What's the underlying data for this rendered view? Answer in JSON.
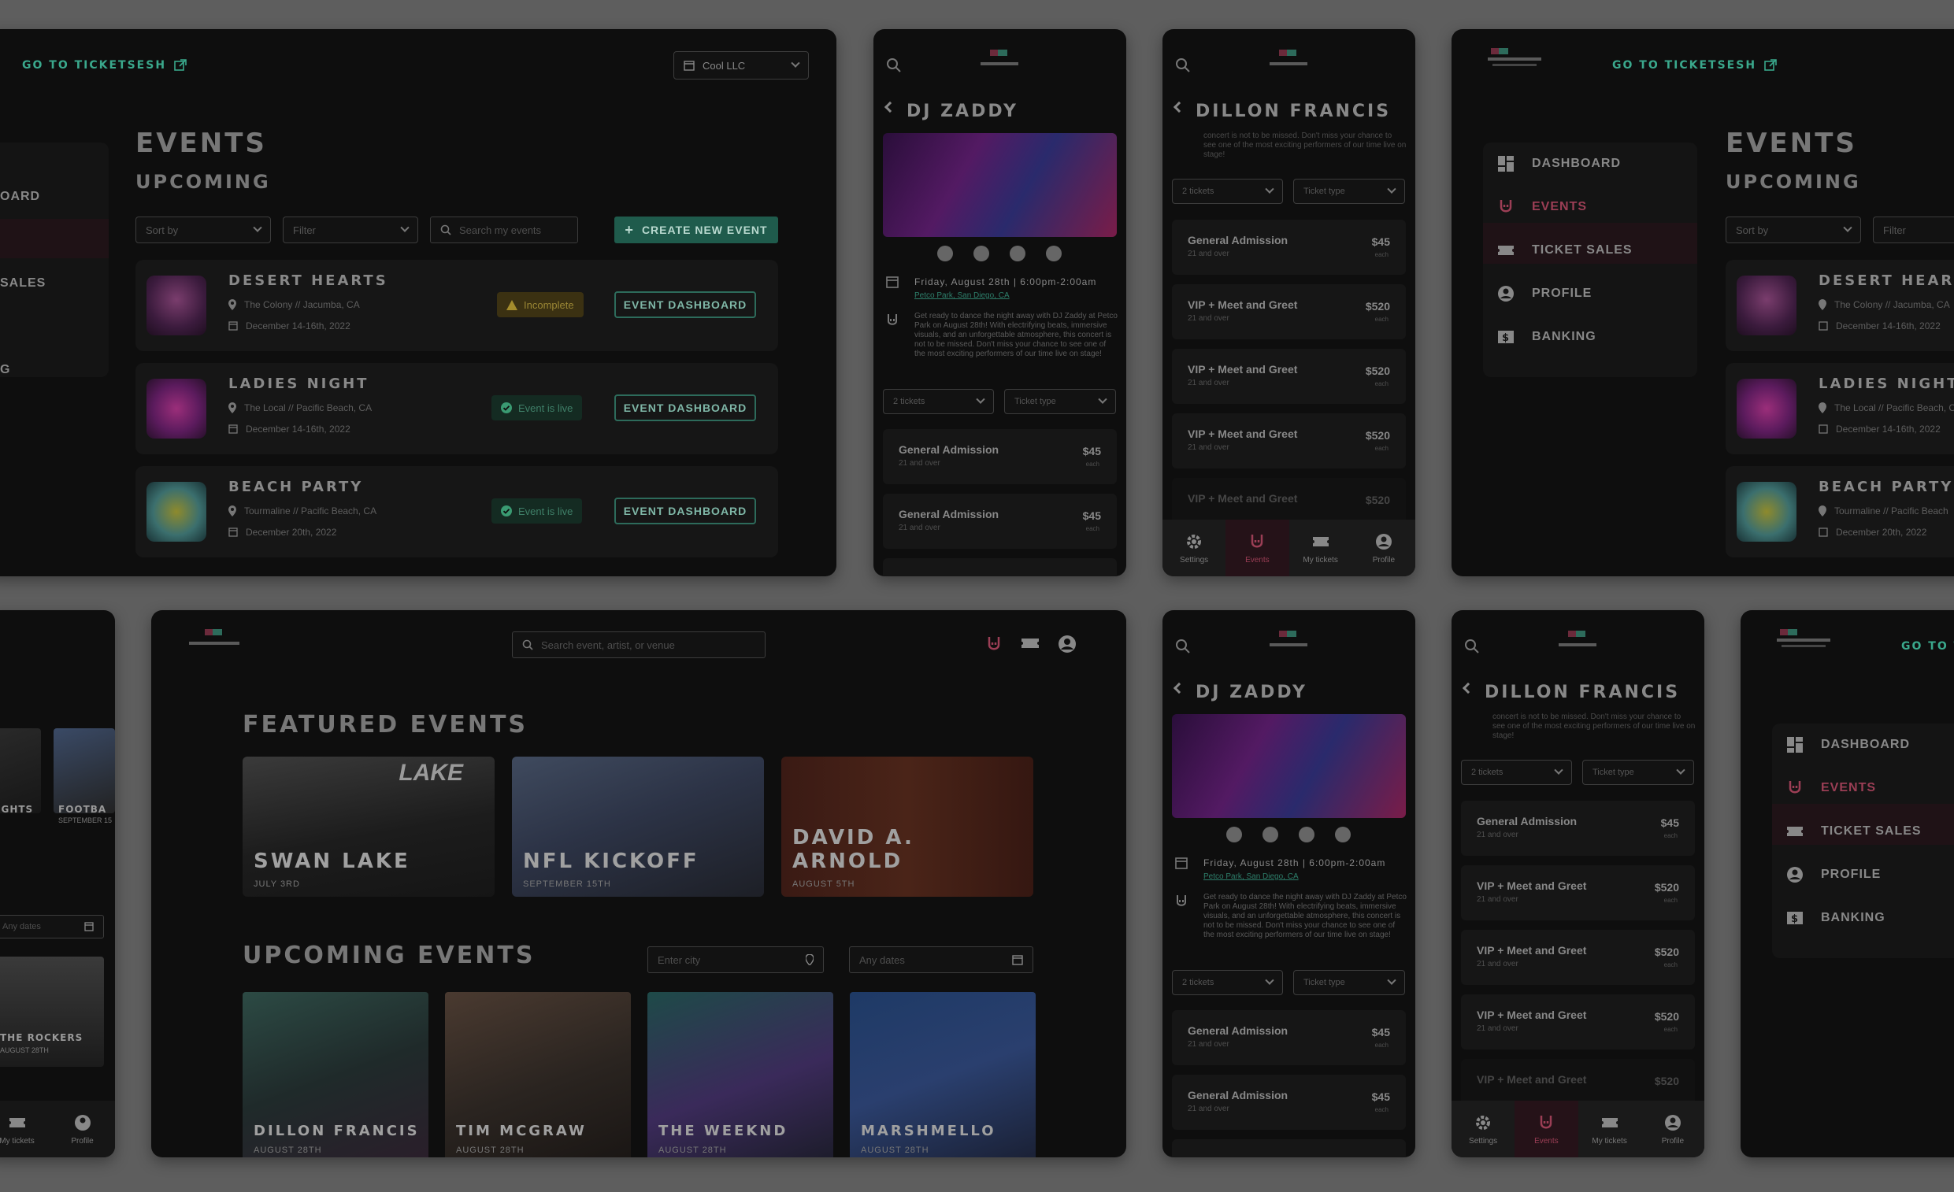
{
  "admin": {
    "go_to": "GO TO TICKETSESH",
    "org_select": "Cool LLC",
    "title": "EVENTS",
    "subtitle": "UPCOMING",
    "sort_placeholder": "Sort by",
    "filter_placeholder": "Filter",
    "search_placeholder": "Search my events",
    "create_button": "CREATE NEW EVENT",
    "dashboard_button": "EVENT DASHBOARD",
    "sidebar_partial": [
      "OARD",
      "",
      "SALES",
      "",
      "G"
    ],
    "events": [
      {
        "name": "DESERT HEARTS",
        "venue": "The Colony // Jacumba, CA",
        "date": "December 14-16th, 2022",
        "status": "Incomplete"
      },
      {
        "name": "LADIES NIGHT",
        "venue": "The Local // Pacific Beach, CA",
        "date": "December 14-16th, 2022",
        "status": "Event is live"
      },
      {
        "name": "BEACH PARTY",
        "venue": "Tourmaline // Pacific Beach, CA",
        "date": "December 20th, 2022",
        "status": "Event is live"
      }
    ],
    "sidebar": [
      {
        "label": "DASHBOARD",
        "icon": "grid-icon"
      },
      {
        "label": "EVENTS",
        "icon": "rock-hand-icon"
      },
      {
        "label": "TICKET SALES",
        "icon": "ticket-icon"
      },
      {
        "label": "PROFILE",
        "icon": "user-circle-icon"
      },
      {
        "label": "BANKING",
        "icon": "dollar-icon"
      }
    ],
    "right_events": [
      {
        "name": "DESERT HEAR",
        "venue": "The Colony // Jacumba, CA",
        "date": "December 14-16th, 2022"
      },
      {
        "name": "LADIES NIGHT",
        "venue": "The Local // Pacific Beach, C",
        "date": "December 14-16th, 2022"
      },
      {
        "name": "BEACH PARTY",
        "venue": "Tourmaline // Pacific Beach",
        "date": "December 20th, 2022"
      }
    ],
    "right_go_to": "GO TO TI"
  },
  "mobile": {
    "dj_title": "DJ ZADDY",
    "dillon_title": "DILLON FRANCIS",
    "date_line": "Friday, August 28th | 6:00pm-2:00am",
    "venue_link": "Petco Park, San Diego, CA",
    "description": "Get ready to dance the night away with DJ Zaddy at Petco Park on August 28th! With electrifying beats, immersive visuals, and an unforgettable atmosphere, this concert is not to be missed. Don't miss your chance to see one of the most exciting performers of our time live on stage!",
    "description_tail": "concert is not to be missed. Don't miss your chance to see one of the most exciting performers of our time live on stage!",
    "tickets_select": "2 tickets",
    "ticket_type_select": "Ticket type",
    "tiers_short": [
      {
        "name": "General Admission",
        "age": "21 and over",
        "price": "$45",
        "each": "each"
      },
      {
        "name": "General Admission",
        "age": "21 and over",
        "price": "$45",
        "each": "each"
      }
    ],
    "tiers_long": [
      {
        "name": "General Admission",
        "age": "21 and over",
        "price": "$45",
        "each": "each"
      },
      {
        "name": "VIP + Meet and Greet",
        "age": "21 and over",
        "price": "$520",
        "each": "each"
      },
      {
        "name": "VIP + Meet and Greet",
        "age": "21 and over",
        "price": "$520",
        "each": "each"
      },
      {
        "name": "VIP + Meet and Greet",
        "age": "21 and over",
        "price": "$520",
        "each": "each"
      },
      {
        "name": "VIP + Meet and Greet",
        "age": "21 and over",
        "price": "$520",
        "each": "each"
      }
    ],
    "tabs": [
      {
        "label": "Settings",
        "icon": "gear-icon"
      },
      {
        "label": "Events",
        "icon": "rock-hand-icon"
      },
      {
        "label": "My tickets",
        "icon": "ticket-icon"
      },
      {
        "label": "Profile",
        "icon": "user-circle-icon"
      }
    ]
  },
  "consumer": {
    "search_placeholder": "Search event, artist, or venue",
    "featured_title": "FEATURED EVENTS",
    "featured": [
      {
        "name": "SWAN LAKE",
        "date": "JULY 3RD",
        "overlay": "LAKE"
      },
      {
        "name": "NFL KICKOFF",
        "date": "SEPTEMBER 15TH"
      },
      {
        "name": "DAVID A. ARNOLD",
        "date": "AUGUST 5TH"
      }
    ],
    "upcoming_title": "UPCOMING EVENTS",
    "city_placeholder": "Enter city",
    "dates_placeholder": "Any dates",
    "upcoming": [
      {
        "name": "DILLON FRANCIS",
        "date": "AUGUST 28TH"
      },
      {
        "name": "TIM MCGRAW",
        "date": "AUGUST 28TH"
      },
      {
        "name": "THE WEEKND",
        "date": "AUGUST 28TH"
      },
      {
        "name": "MARSHMELLO",
        "date": "AUGUST 28TH"
      }
    ]
  },
  "left_partial": {
    "labels": [
      "IGHTS",
      "FOOTBA"
    ],
    "date": "SEPTEMBER 15",
    "dates_placeholder": "Any dates",
    "rockers": "THE ROCKERS",
    "rockers_date": "AUGUST 28TH",
    "tabs": [
      "My tickets",
      "Profile"
    ]
  },
  "colors": {
    "accent_teal": "#3aa88c",
    "accent_pink": "#9b3e55",
    "panel_bg": "#0e0e0e",
    "page_bg": "#5e5e5e"
  }
}
